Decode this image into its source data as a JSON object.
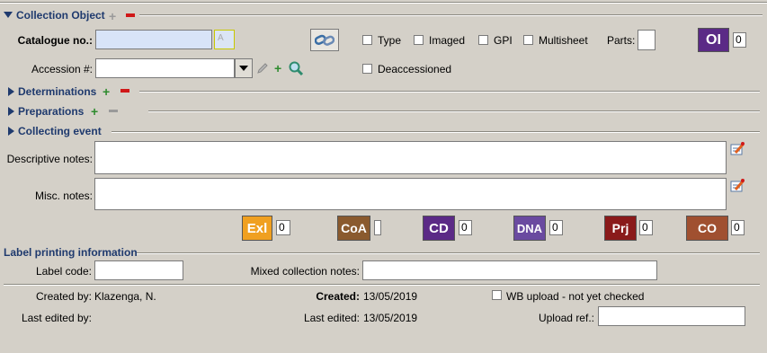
{
  "collection_object": {
    "title": "Collection Object",
    "catalogue_label": "Catalogue no.:",
    "catalogue_value": "",
    "catalogue_format_glyph": "A",
    "accession_label": "Accession #:",
    "accession_value": "",
    "checks": {
      "type": "Type",
      "imaged": "Imaged",
      "gpi": "GPI",
      "multisheet": "Multisheet",
      "deaccessioned": "Deaccessioned"
    },
    "parts_label": "Parts:",
    "parts_value": "",
    "oi_badge": "OI",
    "oi_count": "0"
  },
  "sections": {
    "determinations": "Determinations",
    "preparations": "Preparations",
    "collecting_event": "Collecting event"
  },
  "notes": {
    "descriptive_label": "Descriptive notes:",
    "misc_label": "Misc. notes:"
  },
  "attachments": [
    {
      "badge": "Exl",
      "count": "0",
      "color": "#f0a020",
      "name": "exl"
    },
    {
      "badge": "CoA",
      "count": "",
      "color": "#8a5a2e",
      "name": "coa"
    },
    {
      "badge": "CD",
      "count": "0",
      "color": "#5b2a86",
      "name": "cd"
    },
    {
      "badge": "DNA",
      "count": "0",
      "color": "#6a4aa0",
      "name": "dna"
    },
    {
      "badge": "Prj",
      "count": "0",
      "color": "#8a1a1a",
      "name": "prj"
    },
    {
      "badge": "CO",
      "count": "0",
      "color": "#a05030",
      "name": "co"
    }
  ],
  "label_printing": {
    "title": "Label printing information",
    "label_code_label": "Label code:",
    "label_code_value": "",
    "mixed_label": "Mixed collection notes:",
    "mixed_value": ""
  },
  "footer": {
    "created_by_label": "Created by:",
    "created_by_value": "Klazenga, N.",
    "created_label": "Created:",
    "created_value": "13/05/2019",
    "wb_upload_label": "WB upload - not yet checked",
    "last_edited_by_label": "Last edited by:",
    "last_edited_by_value": "",
    "last_edited_label": "Last edited:",
    "last_edited_value": "13/05/2019",
    "upload_ref_label": "Upload ref.:",
    "upload_ref_value": ""
  }
}
